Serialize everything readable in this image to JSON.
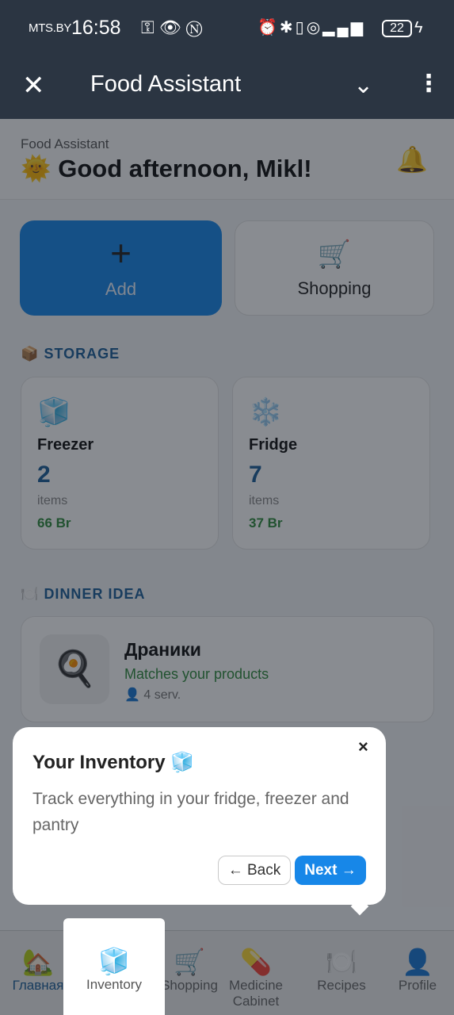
{
  "statusbar": {
    "carrier": "MTS.BY",
    "time": "16:58",
    "left_icons": [
      "key-icon",
      "eye-icon",
      "nfc-icon"
    ],
    "right_icons": [
      "alarm-icon",
      "bluetooth-icon",
      "vibrate-icon",
      "hotspot-icon",
      "signal-4g-icon"
    ],
    "battery": "22"
  },
  "appbar": {
    "close_glyph": "✕",
    "title": "Food Assistant",
    "collapse_glyph": "⌄",
    "menu_glyph": "⋮"
  },
  "header": {
    "subtitle": "Food Assistant",
    "greeting_emoji": "🌞",
    "greeting": "Good afternoon, Mikl!",
    "bell_glyph": "🔔"
  },
  "actions": {
    "add": {
      "icon": "+",
      "label": "Add"
    },
    "shopping": {
      "icon": "🛒",
      "label": "Shopping"
    }
  },
  "storage": {
    "title_icon": "📦",
    "title": "STORAGE",
    "cards": [
      {
        "icon": "🧊",
        "name": "Freezer",
        "count": "2",
        "unit": "items",
        "price": "66 Br"
      },
      {
        "icon": "❄️",
        "name": "Fridge",
        "count": "7",
        "unit": "items",
        "price": "37 Br"
      }
    ]
  },
  "dinner": {
    "title_icon": "🍽️",
    "title": "DINNER IDEA",
    "dish_icon": "🍳",
    "dish_name": "Драники",
    "match": "Matches your products",
    "servings": "👤 4 serv."
  },
  "tour": {
    "title": "Your Inventory 🧊",
    "description": "Track everything in your fridge, freezer and pantry",
    "back": "← Back",
    "next": "Next →",
    "close": "×"
  },
  "nav": [
    {
      "icon": "🏡",
      "label": "Главная"
    },
    {
      "icon": "🧊",
      "label": "Inventory"
    },
    {
      "icon": "🛒",
      "label": "Shopping"
    },
    {
      "icon": "💊",
      "label": "Medicine Cabinet"
    },
    {
      "icon": "🍽️",
      "label": "Recipes"
    },
    {
      "icon": "👤",
      "label": "Profile"
    }
  ],
  "colors": {
    "accent": "#1787e8",
    "header": "#2b3542",
    "section": "#1d5f98",
    "money": "#2f8a3c"
  }
}
